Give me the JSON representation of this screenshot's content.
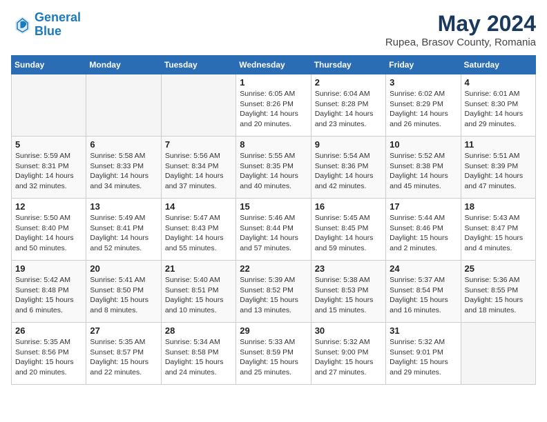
{
  "header": {
    "logo_line1": "General",
    "logo_line2": "Blue",
    "month_year": "May 2024",
    "location": "Rupea, Brasov County, Romania"
  },
  "weekdays": [
    "Sunday",
    "Monday",
    "Tuesday",
    "Wednesday",
    "Thursday",
    "Friday",
    "Saturday"
  ],
  "weeks": [
    [
      {
        "day": "",
        "info": ""
      },
      {
        "day": "",
        "info": ""
      },
      {
        "day": "",
        "info": ""
      },
      {
        "day": "1",
        "info": "Sunrise: 6:05 AM\nSunset: 8:26 PM\nDaylight: 14 hours\nand 20 minutes."
      },
      {
        "day": "2",
        "info": "Sunrise: 6:04 AM\nSunset: 8:28 PM\nDaylight: 14 hours\nand 23 minutes."
      },
      {
        "day": "3",
        "info": "Sunrise: 6:02 AM\nSunset: 8:29 PM\nDaylight: 14 hours\nand 26 minutes."
      },
      {
        "day": "4",
        "info": "Sunrise: 6:01 AM\nSunset: 8:30 PM\nDaylight: 14 hours\nand 29 minutes."
      }
    ],
    [
      {
        "day": "5",
        "info": "Sunrise: 5:59 AM\nSunset: 8:31 PM\nDaylight: 14 hours\nand 32 minutes."
      },
      {
        "day": "6",
        "info": "Sunrise: 5:58 AM\nSunset: 8:33 PM\nDaylight: 14 hours\nand 34 minutes."
      },
      {
        "day": "7",
        "info": "Sunrise: 5:56 AM\nSunset: 8:34 PM\nDaylight: 14 hours\nand 37 minutes."
      },
      {
        "day": "8",
        "info": "Sunrise: 5:55 AM\nSunset: 8:35 PM\nDaylight: 14 hours\nand 40 minutes."
      },
      {
        "day": "9",
        "info": "Sunrise: 5:54 AM\nSunset: 8:36 PM\nDaylight: 14 hours\nand 42 minutes."
      },
      {
        "day": "10",
        "info": "Sunrise: 5:52 AM\nSunset: 8:38 PM\nDaylight: 14 hours\nand 45 minutes."
      },
      {
        "day": "11",
        "info": "Sunrise: 5:51 AM\nSunset: 8:39 PM\nDaylight: 14 hours\nand 47 minutes."
      }
    ],
    [
      {
        "day": "12",
        "info": "Sunrise: 5:50 AM\nSunset: 8:40 PM\nDaylight: 14 hours\nand 50 minutes."
      },
      {
        "day": "13",
        "info": "Sunrise: 5:49 AM\nSunset: 8:41 PM\nDaylight: 14 hours\nand 52 minutes."
      },
      {
        "day": "14",
        "info": "Sunrise: 5:47 AM\nSunset: 8:43 PM\nDaylight: 14 hours\nand 55 minutes."
      },
      {
        "day": "15",
        "info": "Sunrise: 5:46 AM\nSunset: 8:44 PM\nDaylight: 14 hours\nand 57 minutes."
      },
      {
        "day": "16",
        "info": "Sunrise: 5:45 AM\nSunset: 8:45 PM\nDaylight: 14 hours\nand 59 minutes."
      },
      {
        "day": "17",
        "info": "Sunrise: 5:44 AM\nSunset: 8:46 PM\nDaylight: 15 hours\nand 2 minutes."
      },
      {
        "day": "18",
        "info": "Sunrise: 5:43 AM\nSunset: 8:47 PM\nDaylight: 15 hours\nand 4 minutes."
      }
    ],
    [
      {
        "day": "19",
        "info": "Sunrise: 5:42 AM\nSunset: 8:48 PM\nDaylight: 15 hours\nand 6 minutes."
      },
      {
        "day": "20",
        "info": "Sunrise: 5:41 AM\nSunset: 8:50 PM\nDaylight: 15 hours\nand 8 minutes."
      },
      {
        "day": "21",
        "info": "Sunrise: 5:40 AM\nSunset: 8:51 PM\nDaylight: 15 hours\nand 10 minutes."
      },
      {
        "day": "22",
        "info": "Sunrise: 5:39 AM\nSunset: 8:52 PM\nDaylight: 15 hours\nand 13 minutes."
      },
      {
        "day": "23",
        "info": "Sunrise: 5:38 AM\nSunset: 8:53 PM\nDaylight: 15 hours\nand 15 minutes."
      },
      {
        "day": "24",
        "info": "Sunrise: 5:37 AM\nSunset: 8:54 PM\nDaylight: 15 hours\nand 16 minutes."
      },
      {
        "day": "25",
        "info": "Sunrise: 5:36 AM\nSunset: 8:55 PM\nDaylight: 15 hours\nand 18 minutes."
      }
    ],
    [
      {
        "day": "26",
        "info": "Sunrise: 5:35 AM\nSunset: 8:56 PM\nDaylight: 15 hours\nand 20 minutes."
      },
      {
        "day": "27",
        "info": "Sunrise: 5:35 AM\nSunset: 8:57 PM\nDaylight: 15 hours\nand 22 minutes."
      },
      {
        "day": "28",
        "info": "Sunrise: 5:34 AM\nSunset: 8:58 PM\nDaylight: 15 hours\nand 24 minutes."
      },
      {
        "day": "29",
        "info": "Sunrise: 5:33 AM\nSunset: 8:59 PM\nDaylight: 15 hours\nand 25 minutes."
      },
      {
        "day": "30",
        "info": "Sunrise: 5:32 AM\nSunset: 9:00 PM\nDaylight: 15 hours\nand 27 minutes."
      },
      {
        "day": "31",
        "info": "Sunrise: 5:32 AM\nSunset: 9:01 PM\nDaylight: 15 hours\nand 29 minutes."
      },
      {
        "day": "",
        "info": ""
      }
    ]
  ]
}
